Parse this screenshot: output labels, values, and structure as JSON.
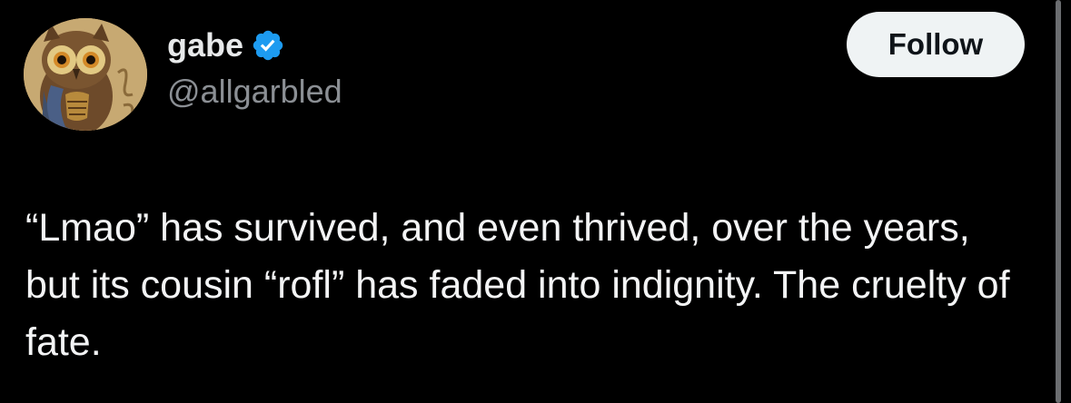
{
  "author": {
    "display_name": "gabe",
    "handle": "@allgarbled",
    "verified": true,
    "avatar_icon": "owl-avatar-icon"
  },
  "actions": {
    "follow_label": "Follow"
  },
  "tweet": {
    "text": "“Lmao” has survived, and even thrived, over the years, but its cousin “rofl” has faded into indignity. The cruelty of fate."
  },
  "colors": {
    "background": "#000000",
    "text": "#e7e9ea",
    "handle": "#8b8f94",
    "verified_badge": "#1d9bf0",
    "follow_button_bg": "#eff3f4",
    "follow_button_text": "#0f1419"
  }
}
